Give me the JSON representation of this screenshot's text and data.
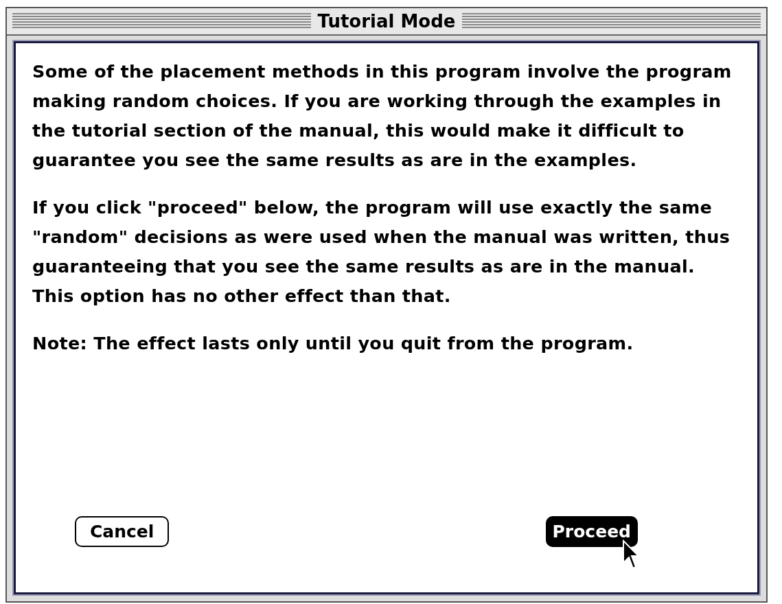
{
  "window": {
    "title": "Tutorial Mode"
  },
  "paragraphs": [
    "Some of the placement methods in this program involve the program making random choices.  If you are working through the examples in the tutorial section of the manual, this would make it difficult to guarantee you see the same results as are in the examples.",
    "If you click \"proceed\" below, the program will use exactly the same \"random\" decisions as were used when the manual was written, thus guaranteeing that you see the same results as are in the manual.  This option has no other effect than that.",
    "Note:  The effect lasts only until you quit from the program."
  ],
  "buttons": [
    {
      "label": "Cancel",
      "pressed": false
    },
    {
      "label": "Proceed",
      "pressed": true
    }
  ]
}
